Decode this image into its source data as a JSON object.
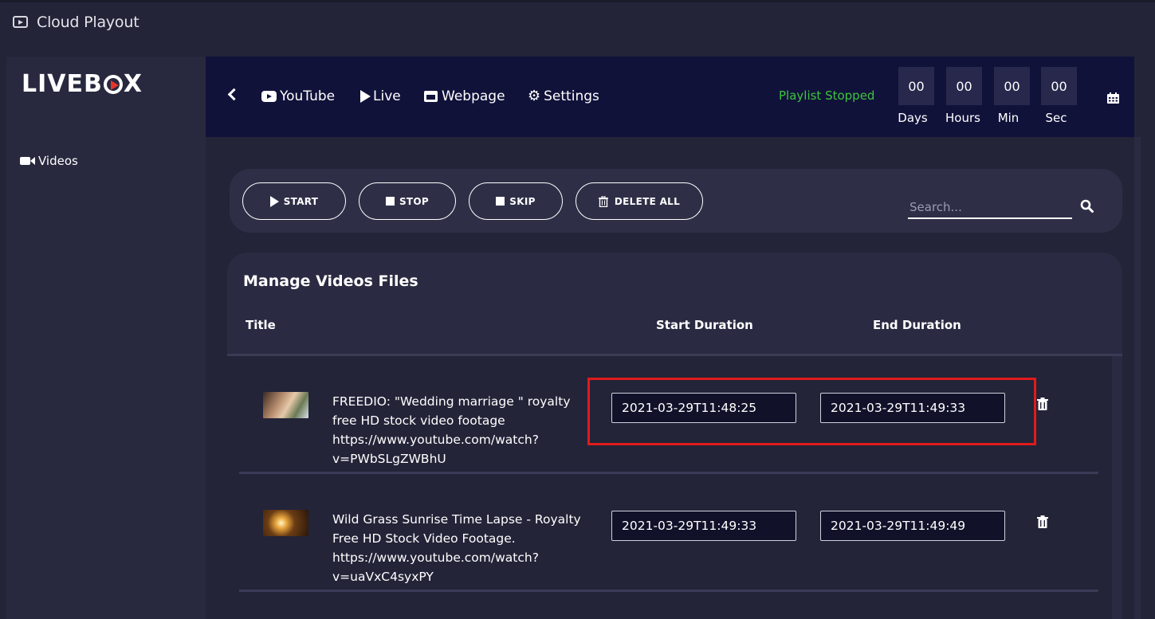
{
  "app": {
    "title": "Cloud Playout",
    "icon": "youtube-outline-icon"
  },
  "sidebar": {
    "logo": {
      "prefix": "LIVEB",
      "suffix": "X",
      "brand_color": "#e8342b"
    },
    "items": [
      {
        "label": "Videos",
        "icon": "video-camera-icon"
      }
    ]
  },
  "topnav": {
    "items": [
      {
        "label": "YouTube",
        "icon": "youtube-icon"
      },
      {
        "label": "Live",
        "icon": "play-icon"
      },
      {
        "label": "Webpage",
        "icon": "window-icon"
      },
      {
        "label": "Settings",
        "icon": "gear-icon"
      }
    ],
    "status": "Playlist Stopped",
    "status_color": "#3ec43e",
    "countdown": [
      {
        "value": "00",
        "label": "Days"
      },
      {
        "value": "00",
        "label": "Hours"
      },
      {
        "value": "00",
        "label": "Min"
      },
      {
        "value": "00",
        "label": "Sec"
      }
    ]
  },
  "toolbar": {
    "buttons": [
      {
        "label": "START",
        "icon": "play-icon"
      },
      {
        "label": "STOP",
        "icon": "stop-icon"
      },
      {
        "label": "SKIP",
        "icon": "stop-icon"
      },
      {
        "label": "DELETE ALL",
        "icon": "trash-icon"
      }
    ],
    "search": {
      "placeholder": "Search...",
      "value": ""
    }
  },
  "files": {
    "title": "Manage Videos Files",
    "columns": {
      "title": "Title",
      "start": "Start Duration",
      "end": "End Duration"
    },
    "rows": [
      {
        "title": "FREEDIO: \"Wedding marriage \" royalty free HD stock video footage https://www.youtube.com/watch?v=PWbSLgZWBhU",
        "start": "2021-03-29T11:48:25",
        "end": "2021-03-29T11:49:33",
        "highlighted": true
      },
      {
        "title": "Wild Grass Sunrise Time Lapse - Royalty Free HD Stock Video Footage. https://www.youtube.com/watch?v=uaVxC4syxPY",
        "start": "2021-03-29T11:49:33",
        "end": "2021-03-29T11:49:49",
        "highlighted": false
      }
    ]
  }
}
